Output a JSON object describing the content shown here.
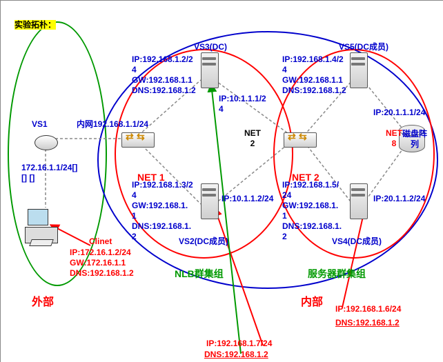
{
  "title": "实验拓朴：",
  "zones": {
    "outer": "外部",
    "inner": "内部",
    "nlb": "NLB群集组",
    "srv": "服务器群集组"
  },
  "nets": {
    "net1": "NET 1",
    "netx1": "NET\n2",
    "net2": "NET 2",
    "netx2": "NET\n8"
  },
  "devices": {
    "vs1": "VS1",
    "vs3": "VS3(DC)",
    "vs5": "VS5(DC成员)",
    "vs2": "VS2(DC成员)",
    "vs4": "VS4(DC成员)",
    "disk": "磁盘阵\n列",
    "client": "Clinet"
  },
  "ip": {
    "vs1_outside": "172.16.1.1/24[]\n[] []",
    "vs1_inside": "内网192.168.1.1/24",
    "vs3_left": "IP:192.168.1.2/2\n4\nGW:192.168.1.1\nDNS:192.168.1.2",
    "vs3_right": "IP:10.1.1.1/2\n4",
    "vs5_left": "IP:192.168.1.4/2\n4\nGW:192.168.1.1\nDNS:192.168.1.2",
    "vs5_right": "IP:20.1.1.1/24",
    "vs2_left": "IP:192.168.1.3/2\n4\nGW:192.168.1.\n1\nDNS:192.168.1.\n2",
    "vs2_right": "IP:10.1.1.2/24",
    "vs4_left": "IP:192.168.1.5/\n24\nGW:192.168.1.\n1\nDNS:192.168.1.\n2",
    "vs4_right": "IP:20.1.1.2/24",
    "client": "IP:172.16.1.2/24\nGW:172.16.1.1\nDNS:192.168.1.2",
    "inner1": "IP:192.168.1.6/24",
    "inner1_dns": "DNS:192.168.1.2",
    "inner2": "IP:192.168.1.7/24",
    "inner2_dns": "DNS:192.168.1.2"
  }
}
